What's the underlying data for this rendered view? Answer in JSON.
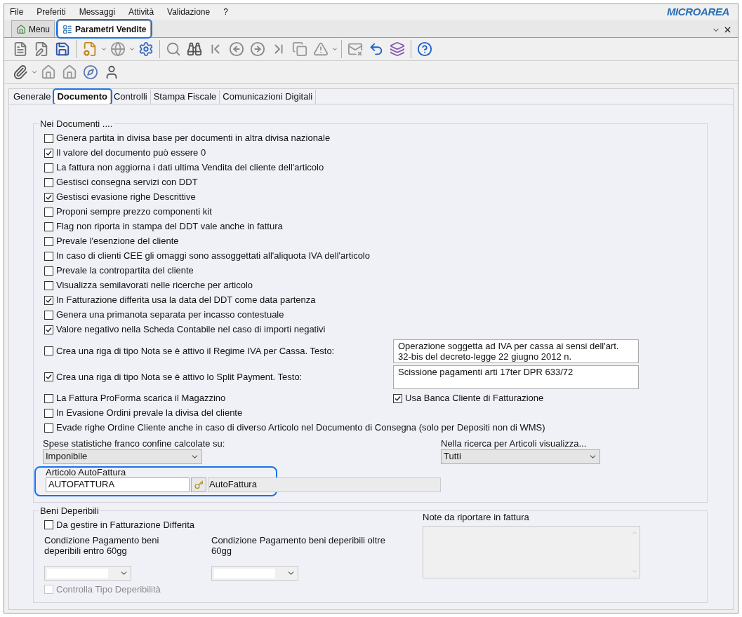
{
  "menu": [
    "File",
    "Preferiti",
    "Messaggi",
    "Attività",
    "Validazione",
    "?"
  ],
  "logo": "MICROAREA",
  "doc_tabs": [
    {
      "label": "Menu",
      "selected": false,
      "highlighted": false
    },
    {
      "label": "Parametri Vendite",
      "selected": true,
      "highlighted": true
    }
  ],
  "page_tabs": [
    {
      "label": "Generale",
      "selected": false,
      "highlighted": false
    },
    {
      "label": "Documento",
      "selected": true,
      "highlighted": true
    },
    {
      "label": "Controlli",
      "selected": false,
      "highlighted": false
    },
    {
      "label": "Stampa Fiscale",
      "selected": false,
      "highlighted": false
    },
    {
      "label": "Comunicazioni Digitali",
      "selected": false,
      "highlighted": false
    }
  ],
  "nei_documenti": {
    "title": "Nei Documenti ....",
    "options": [
      {
        "kind": "checkbox",
        "label": "Genera partita in divisa base per documenti in altra divisa nazionale",
        "checked": false
      },
      {
        "kind": "checkbox",
        "label": "Il valore del documento può essere 0",
        "checked": true
      },
      {
        "kind": "checkbox",
        "label": "La fattura non aggiorna i dati ultima Vendita del cliente dell'articolo",
        "checked": false
      },
      {
        "kind": "checkbox",
        "label": "Gestisci consegna servizi con DDT",
        "checked": false
      },
      {
        "kind": "checkbox",
        "label": "Gestisci evasione righe Descrittive",
        "checked": true
      },
      {
        "kind": "checkbox",
        "label": "Proponi sempre prezzo componenti kit",
        "checked": false
      },
      {
        "kind": "checkbox",
        "label": "Flag non riporta in stampa del DDT vale anche in fattura",
        "checked": false
      },
      {
        "kind": "checkbox",
        "label": "Prevale l'esenzione del cliente",
        "checked": false
      },
      {
        "kind": "checkbox",
        "label": "In caso di clienti CEE gli omaggi sono assoggettati all'aliquota IVA dell'articolo",
        "checked": false
      },
      {
        "kind": "checkbox",
        "label": "Prevale la contropartita del cliente",
        "checked": false
      },
      {
        "kind": "checkbox",
        "label": "Visualizza semilavorati nelle ricerche per articolo",
        "checked": false
      },
      {
        "kind": "checkbox",
        "label": "In Fatturazione differita usa la data del DDT come data partenza",
        "checked": true
      },
      {
        "kind": "checkbox",
        "label": "Genera una primanota separata per incasso contestuale",
        "checked": false
      },
      {
        "kind": "checkbox",
        "label": "Valore negativo nella Scheda Contabile nel caso di importi negativi",
        "checked": true
      },
      {
        "kind": "checkbox_note",
        "label": "Crea una riga di tipo Nota se è attivo il Regime IVA per Cassa. Testo:",
        "checked": false,
        "note": "Operazione soggetta ad IVA per cassa ai sensi dell'art. 32-bis del decreto-legge 22 giugno 2012 n."
      },
      {
        "kind": "checkbox_note",
        "label": "Crea una riga di tipo Nota se è attivo lo Split Payment. Testo:",
        "checked": true,
        "note": "Scissione pagamenti arti 17ter DPR 633/72"
      },
      {
        "kind": "checkbox_pair",
        "label": "La Fattura ProForma scarica il Magazzino",
        "checked": false,
        "right": {
          "label": "Usa Banca Cliente di Fatturazione",
          "checked": true
        }
      },
      {
        "kind": "checkbox",
        "label": "In Evasione Ordini prevale la divisa del cliente",
        "checked": false
      },
      {
        "kind": "checkbox",
        "label": "Evade righe Ordine Cliente anche in caso di diverso Articolo nel Documento di Consegna (solo per Depositi non di WMS)",
        "checked": false
      }
    ],
    "spese": {
      "label": "Spese statistiche franco confine calcolate su:",
      "value": "Imponibile"
    },
    "ricerca": {
      "label": "Nella ricerca per Articoli visualizza...",
      "value": "Tutti"
    },
    "autofattura": {
      "label": "Articolo AutoFattura",
      "code": "AUTOFATTURA",
      "description": "AutoFattura",
      "highlighted": true
    }
  },
  "beni_deperibili": {
    "title": "Beni Deperibili",
    "gestire": {
      "label": "Da gestire in Fatturazione Differita",
      "checked": false
    },
    "cond_entro": {
      "label": "Condizione Pagamento beni deperibili entro 60gg"
    },
    "cond_oltre": {
      "label": "Condizione Pagamento beni deperibili oltre 60gg"
    },
    "controlla": {
      "label": "Controlla Tipo Deperibilità",
      "checked": false,
      "disabled": true
    },
    "note": {
      "label": "Note da riportare in fattura"
    }
  }
}
